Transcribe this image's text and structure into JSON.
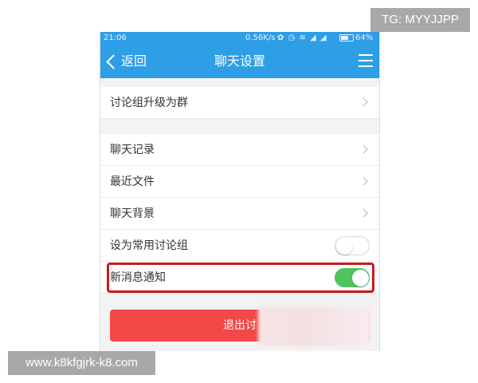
{
  "status_bar": {
    "time": "21:06",
    "speed": "0.56K/s",
    "icons": "✿ ◷ ≋ ◢ ◢",
    "battery": "64%"
  },
  "header": {
    "back_label": "返回",
    "title": "聊天设置"
  },
  "settings": {
    "upgrade_group": "讨论组升级为群",
    "chat_history": "聊天记录",
    "recent_files": "最近文件",
    "chat_background": "聊天背景",
    "set_common_group": "设为常用讨论组",
    "new_message_notify": "新消息通知"
  },
  "toggles": {
    "set_common_group": false,
    "new_message_notify": true
  },
  "exit_button": {
    "label": "退出讨"
  },
  "watermarks": {
    "top_right": "TG: MYYJJPP",
    "bottom_left": "www.k8kfgjrk-k8.com"
  },
  "colors": {
    "accent": "#2e9ee6",
    "toggle_on": "#4dc45e",
    "exit_button": "#f24848",
    "highlight": "#c9191f"
  }
}
